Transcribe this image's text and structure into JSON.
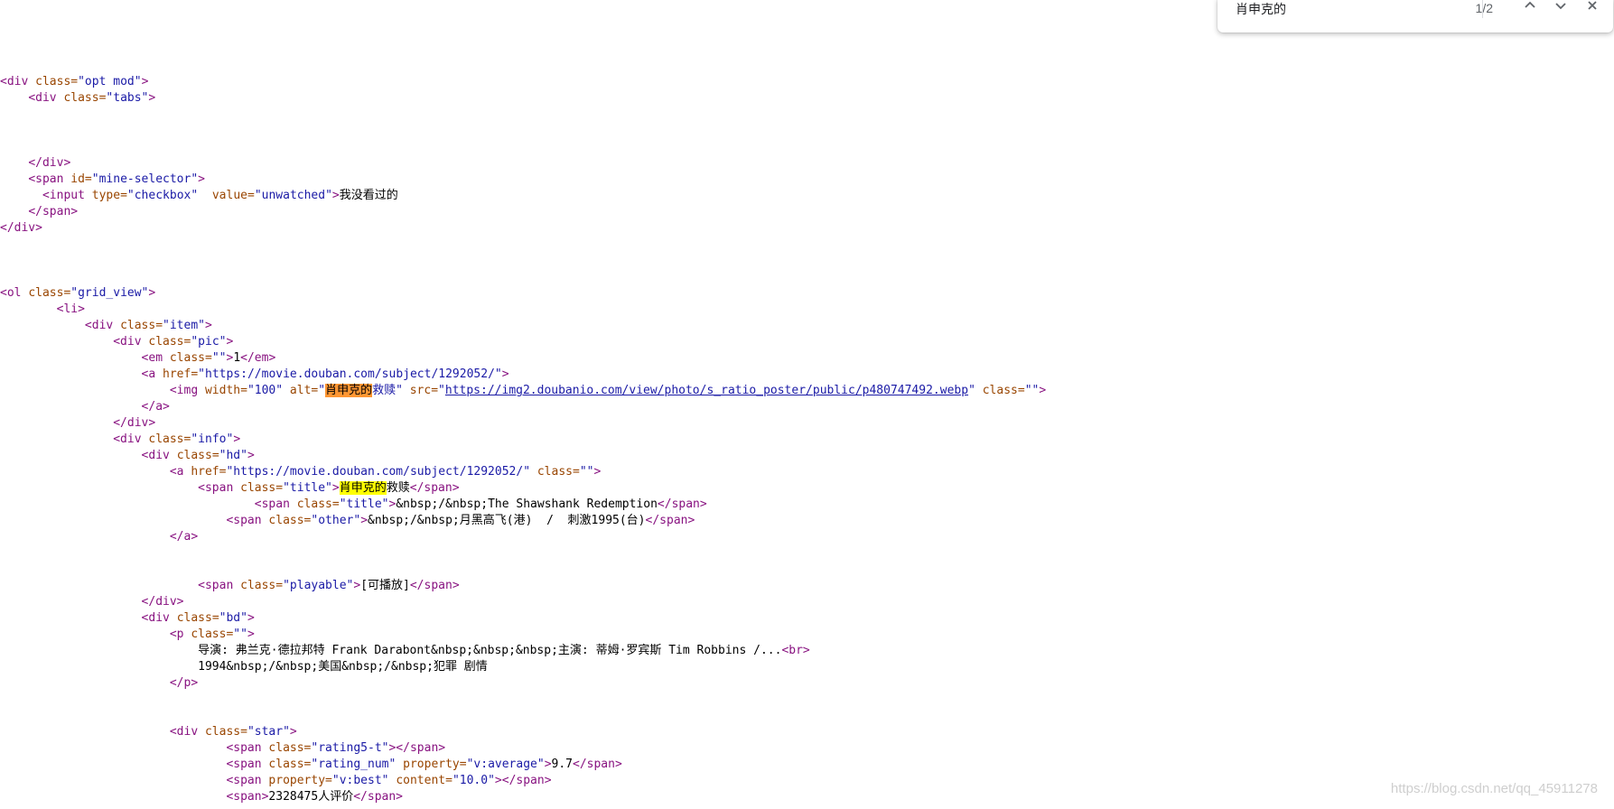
{
  "find_bar": {
    "query": "肖申克的",
    "count": "1/2",
    "prev_label": "previous match",
    "next_label": "next match",
    "close_label": "close find bar"
  },
  "watermark": "https://blog.csdn.net/qq_45911278",
  "code_lines": [
    {
      "indent": 0,
      "segs": [
        [
          "tag",
          "<div "
        ],
        [
          "an",
          "class="
        ],
        [
          "av",
          "\"opt mod\""
        ],
        [
          "tag",
          ">"
        ]
      ]
    },
    {
      "indent": 4,
      "segs": [
        [
          "tag",
          "<div "
        ],
        [
          "an",
          "class="
        ],
        [
          "av",
          "\"tabs\""
        ],
        [
          "tag",
          ">"
        ]
      ]
    },
    {
      "indent": 0,
      "segs": []
    },
    {
      "indent": 0,
      "segs": []
    },
    {
      "indent": 0,
      "segs": []
    },
    {
      "indent": 4,
      "segs": [
        [
          "tag",
          "</div>"
        ]
      ]
    },
    {
      "indent": 4,
      "segs": [
        [
          "tag",
          "<span "
        ],
        [
          "an",
          "id="
        ],
        [
          "av",
          "\"mine-selector\""
        ],
        [
          "tag",
          ">"
        ]
      ]
    },
    {
      "indent": 6,
      "segs": [
        [
          "tag",
          "<input "
        ],
        [
          "an",
          "type="
        ],
        [
          "av",
          "\"checkbox\""
        ],
        [
          "tx",
          "  "
        ],
        [
          "an",
          "value="
        ],
        [
          "av",
          "\"unwatched\""
        ],
        [
          "tag",
          ">"
        ],
        [
          "tx",
          "我没看过的"
        ]
      ]
    },
    {
      "indent": 4,
      "segs": [
        [
          "tag",
          "</span>"
        ]
      ]
    },
    {
      "indent": 0,
      "segs": [
        [
          "tag",
          "</div>"
        ]
      ]
    },
    {
      "indent": 0,
      "segs": []
    },
    {
      "indent": 0,
      "segs": []
    },
    {
      "indent": 0,
      "segs": []
    },
    {
      "indent": 0,
      "segs": [
        [
          "tag",
          "<ol "
        ],
        [
          "an",
          "class="
        ],
        [
          "av",
          "\"grid_view\""
        ],
        [
          "tag",
          ">"
        ]
      ]
    },
    {
      "indent": 8,
      "segs": [
        [
          "tag",
          "<li>"
        ]
      ]
    },
    {
      "indent": 12,
      "segs": [
        [
          "tag",
          "<div "
        ],
        [
          "an",
          "class="
        ],
        [
          "av",
          "\"item\""
        ],
        [
          "tag",
          ">"
        ]
      ]
    },
    {
      "indent": 16,
      "segs": [
        [
          "tag",
          "<div "
        ],
        [
          "an",
          "class="
        ],
        [
          "av",
          "\"pic\""
        ],
        [
          "tag",
          ">"
        ]
      ]
    },
    {
      "indent": 20,
      "segs": [
        [
          "tag",
          "<em "
        ],
        [
          "an",
          "class="
        ],
        [
          "av",
          "\"\""
        ],
        [
          "tag",
          ">"
        ],
        [
          "tx",
          "1"
        ],
        [
          "tag",
          "</em>"
        ]
      ]
    },
    {
      "indent": 20,
      "segs": [
        [
          "tag",
          "<a "
        ],
        [
          "an",
          "href="
        ],
        [
          "av",
          "\"https://movie.douban.com/subject/1292052/\""
        ],
        [
          "tag",
          ">"
        ]
      ]
    },
    {
      "indent": 24,
      "segs": [
        [
          "tag",
          "<img "
        ],
        [
          "an",
          "width="
        ],
        [
          "av",
          "\"100\""
        ],
        [
          "tx",
          " "
        ],
        [
          "an",
          "alt="
        ],
        [
          "av",
          "\""
        ],
        [
          "hl-cur",
          "肖申克的"
        ],
        [
          "av",
          "救赎\""
        ],
        [
          "tx",
          " "
        ],
        [
          "an",
          "src="
        ],
        [
          "av",
          "\""
        ],
        [
          "lk",
          "https://img2.doubanio.com/view/photo/s_ratio_poster/public/p480747492.webp"
        ],
        [
          "av",
          "\""
        ],
        [
          "tx",
          " "
        ],
        [
          "an",
          "class="
        ],
        [
          "av",
          "\"\""
        ],
        [
          "tag",
          ">"
        ]
      ]
    },
    {
      "indent": 20,
      "segs": [
        [
          "tag",
          "</a>"
        ]
      ]
    },
    {
      "indent": 16,
      "segs": [
        [
          "tag",
          "</div>"
        ]
      ]
    },
    {
      "indent": 16,
      "segs": [
        [
          "tag",
          "<div "
        ],
        [
          "an",
          "class="
        ],
        [
          "av",
          "\"info\""
        ],
        [
          "tag",
          ">"
        ]
      ]
    },
    {
      "indent": 20,
      "segs": [
        [
          "tag",
          "<div "
        ],
        [
          "an",
          "class="
        ],
        [
          "av",
          "\"hd\""
        ],
        [
          "tag",
          ">"
        ]
      ]
    },
    {
      "indent": 24,
      "segs": [
        [
          "tag",
          "<a "
        ],
        [
          "an",
          "href="
        ],
        [
          "av",
          "\"https://movie.douban.com/subject/1292052/\""
        ],
        [
          "tx",
          " "
        ],
        [
          "an",
          "class="
        ],
        [
          "av",
          "\"\""
        ],
        [
          "tag",
          ">"
        ]
      ]
    },
    {
      "indent": 28,
      "segs": [
        [
          "tag",
          "<span "
        ],
        [
          "an",
          "class="
        ],
        [
          "av",
          "\"title\""
        ],
        [
          "tag",
          ">"
        ],
        [
          "hl",
          "肖申克的"
        ],
        [
          "tx",
          "救赎"
        ],
        [
          "tag",
          "</span>"
        ]
      ]
    },
    {
      "indent": 36,
      "segs": [
        [
          "tag",
          "<span "
        ],
        [
          "an",
          "class="
        ],
        [
          "av",
          "\"title\""
        ],
        [
          "tag",
          ">"
        ],
        [
          "tx",
          "&nbsp;/&nbsp;The Shawshank Redemption"
        ],
        [
          "tag",
          "</span>"
        ]
      ]
    },
    {
      "indent": 32,
      "segs": [
        [
          "tag",
          "<span "
        ],
        [
          "an",
          "class="
        ],
        [
          "av",
          "\"other\""
        ],
        [
          "tag",
          ">"
        ],
        [
          "tx",
          "&nbsp;/&nbsp;月黑高飞(港)  /  刺激1995(台)"
        ],
        [
          "tag",
          "</span>"
        ]
      ]
    },
    {
      "indent": 24,
      "segs": [
        [
          "tag",
          "</a>"
        ]
      ]
    },
    {
      "indent": 0,
      "segs": []
    },
    {
      "indent": 0,
      "segs": []
    },
    {
      "indent": 28,
      "segs": [
        [
          "tag",
          "<span "
        ],
        [
          "an",
          "class="
        ],
        [
          "av",
          "\"playable\""
        ],
        [
          "tag",
          ">"
        ],
        [
          "tx",
          "[可播放]"
        ],
        [
          "tag",
          "</span>"
        ]
      ]
    },
    {
      "indent": 20,
      "segs": [
        [
          "tag",
          "</div>"
        ]
      ]
    },
    {
      "indent": 20,
      "segs": [
        [
          "tag",
          "<div "
        ],
        [
          "an",
          "class="
        ],
        [
          "av",
          "\"bd\""
        ],
        [
          "tag",
          ">"
        ]
      ]
    },
    {
      "indent": 24,
      "segs": [
        [
          "tag",
          "<p "
        ],
        [
          "an",
          "class="
        ],
        [
          "av",
          "\"\""
        ],
        [
          "tag",
          ">"
        ]
      ]
    },
    {
      "indent": 28,
      "segs": [
        [
          "tx",
          "导演: 弗兰克·德拉邦特 Frank Darabont&nbsp;&nbsp;&nbsp;主演: 蒂姆·罗宾斯 Tim Robbins /..."
        ],
        [
          "tag",
          "<br>"
        ]
      ]
    },
    {
      "indent": 28,
      "segs": [
        [
          "tx",
          "1994&nbsp;/&nbsp;美国&nbsp;/&nbsp;犯罪 剧情"
        ]
      ]
    },
    {
      "indent": 24,
      "segs": [
        [
          "tag",
          "</p>"
        ]
      ]
    },
    {
      "indent": 0,
      "segs": []
    },
    {
      "indent": 0,
      "segs": []
    },
    {
      "indent": 24,
      "segs": [
        [
          "tag",
          "<div "
        ],
        [
          "an",
          "class="
        ],
        [
          "av",
          "\"star\""
        ],
        [
          "tag",
          ">"
        ]
      ]
    },
    {
      "indent": 32,
      "segs": [
        [
          "tag",
          "<span "
        ],
        [
          "an",
          "class="
        ],
        [
          "av",
          "\"rating5-t\""
        ],
        [
          "tag",
          "></span>"
        ]
      ]
    },
    {
      "indent": 32,
      "segs": [
        [
          "tag",
          "<span "
        ],
        [
          "an",
          "class="
        ],
        [
          "av",
          "\"rating_num\""
        ],
        [
          "tx",
          " "
        ],
        [
          "an",
          "property="
        ],
        [
          "av",
          "\"v:average\""
        ],
        [
          "tag",
          ">"
        ],
        [
          "tx",
          "9.7"
        ],
        [
          "tag",
          "</span>"
        ]
      ]
    },
    {
      "indent": 32,
      "segs": [
        [
          "tag",
          "<span "
        ],
        [
          "an",
          "property="
        ],
        [
          "av",
          "\"v:best\""
        ],
        [
          "tx",
          " "
        ],
        [
          "an",
          "content="
        ],
        [
          "av",
          "\"10.0\""
        ],
        [
          "tag",
          "></span>"
        ]
      ]
    },
    {
      "indent": 32,
      "segs": [
        [
          "tag",
          "<span>"
        ],
        [
          "tx",
          "2328475人评价"
        ],
        [
          "tag",
          "</span>"
        ]
      ]
    }
  ]
}
